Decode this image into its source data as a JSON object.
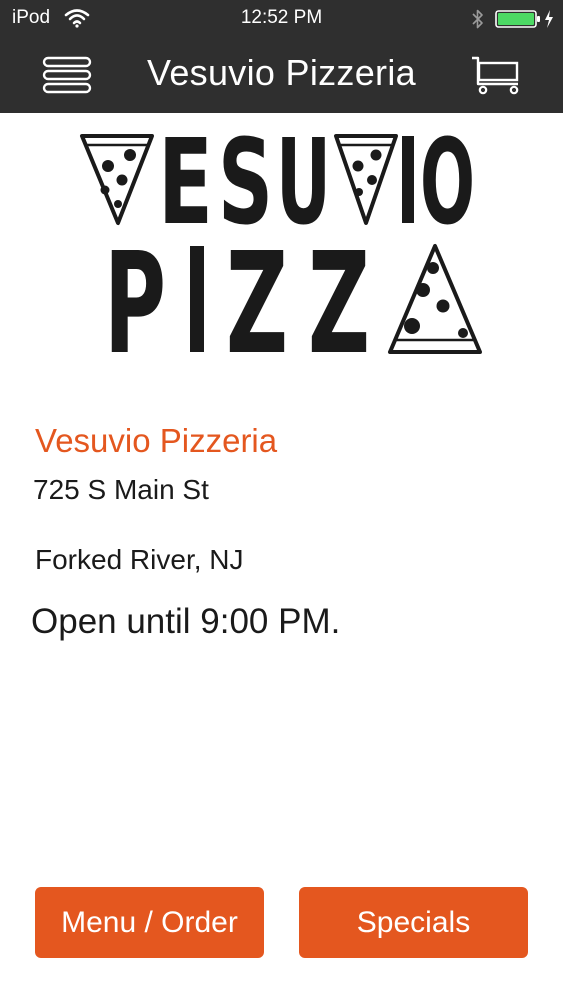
{
  "status_bar": {
    "carrier": "iPod",
    "time": "12:52 PM"
  },
  "nav_bar": {
    "title": "Vesuvio Pizzeria"
  },
  "logo": {
    "line1": "VESUVIO",
    "line2": "PIZZA"
  },
  "restaurant": {
    "name": "Vesuvio Pizzeria",
    "address": "725 S Main St",
    "city": "Forked River, NJ",
    "hours": "Open until 9:00 PM."
  },
  "buttons": {
    "menu_order": "Menu / Order",
    "specials": "Specials"
  },
  "colors": {
    "accent": "#e4571f",
    "bar_background": "#2f2f2f",
    "battery": "#4cd964"
  },
  "icons": {
    "wifi": "wifi-icon",
    "bluetooth": "bluetooth-icon",
    "battery": "battery-icon",
    "menu": "hamburger-menu-icon",
    "cart": "shopping-cart-icon"
  }
}
